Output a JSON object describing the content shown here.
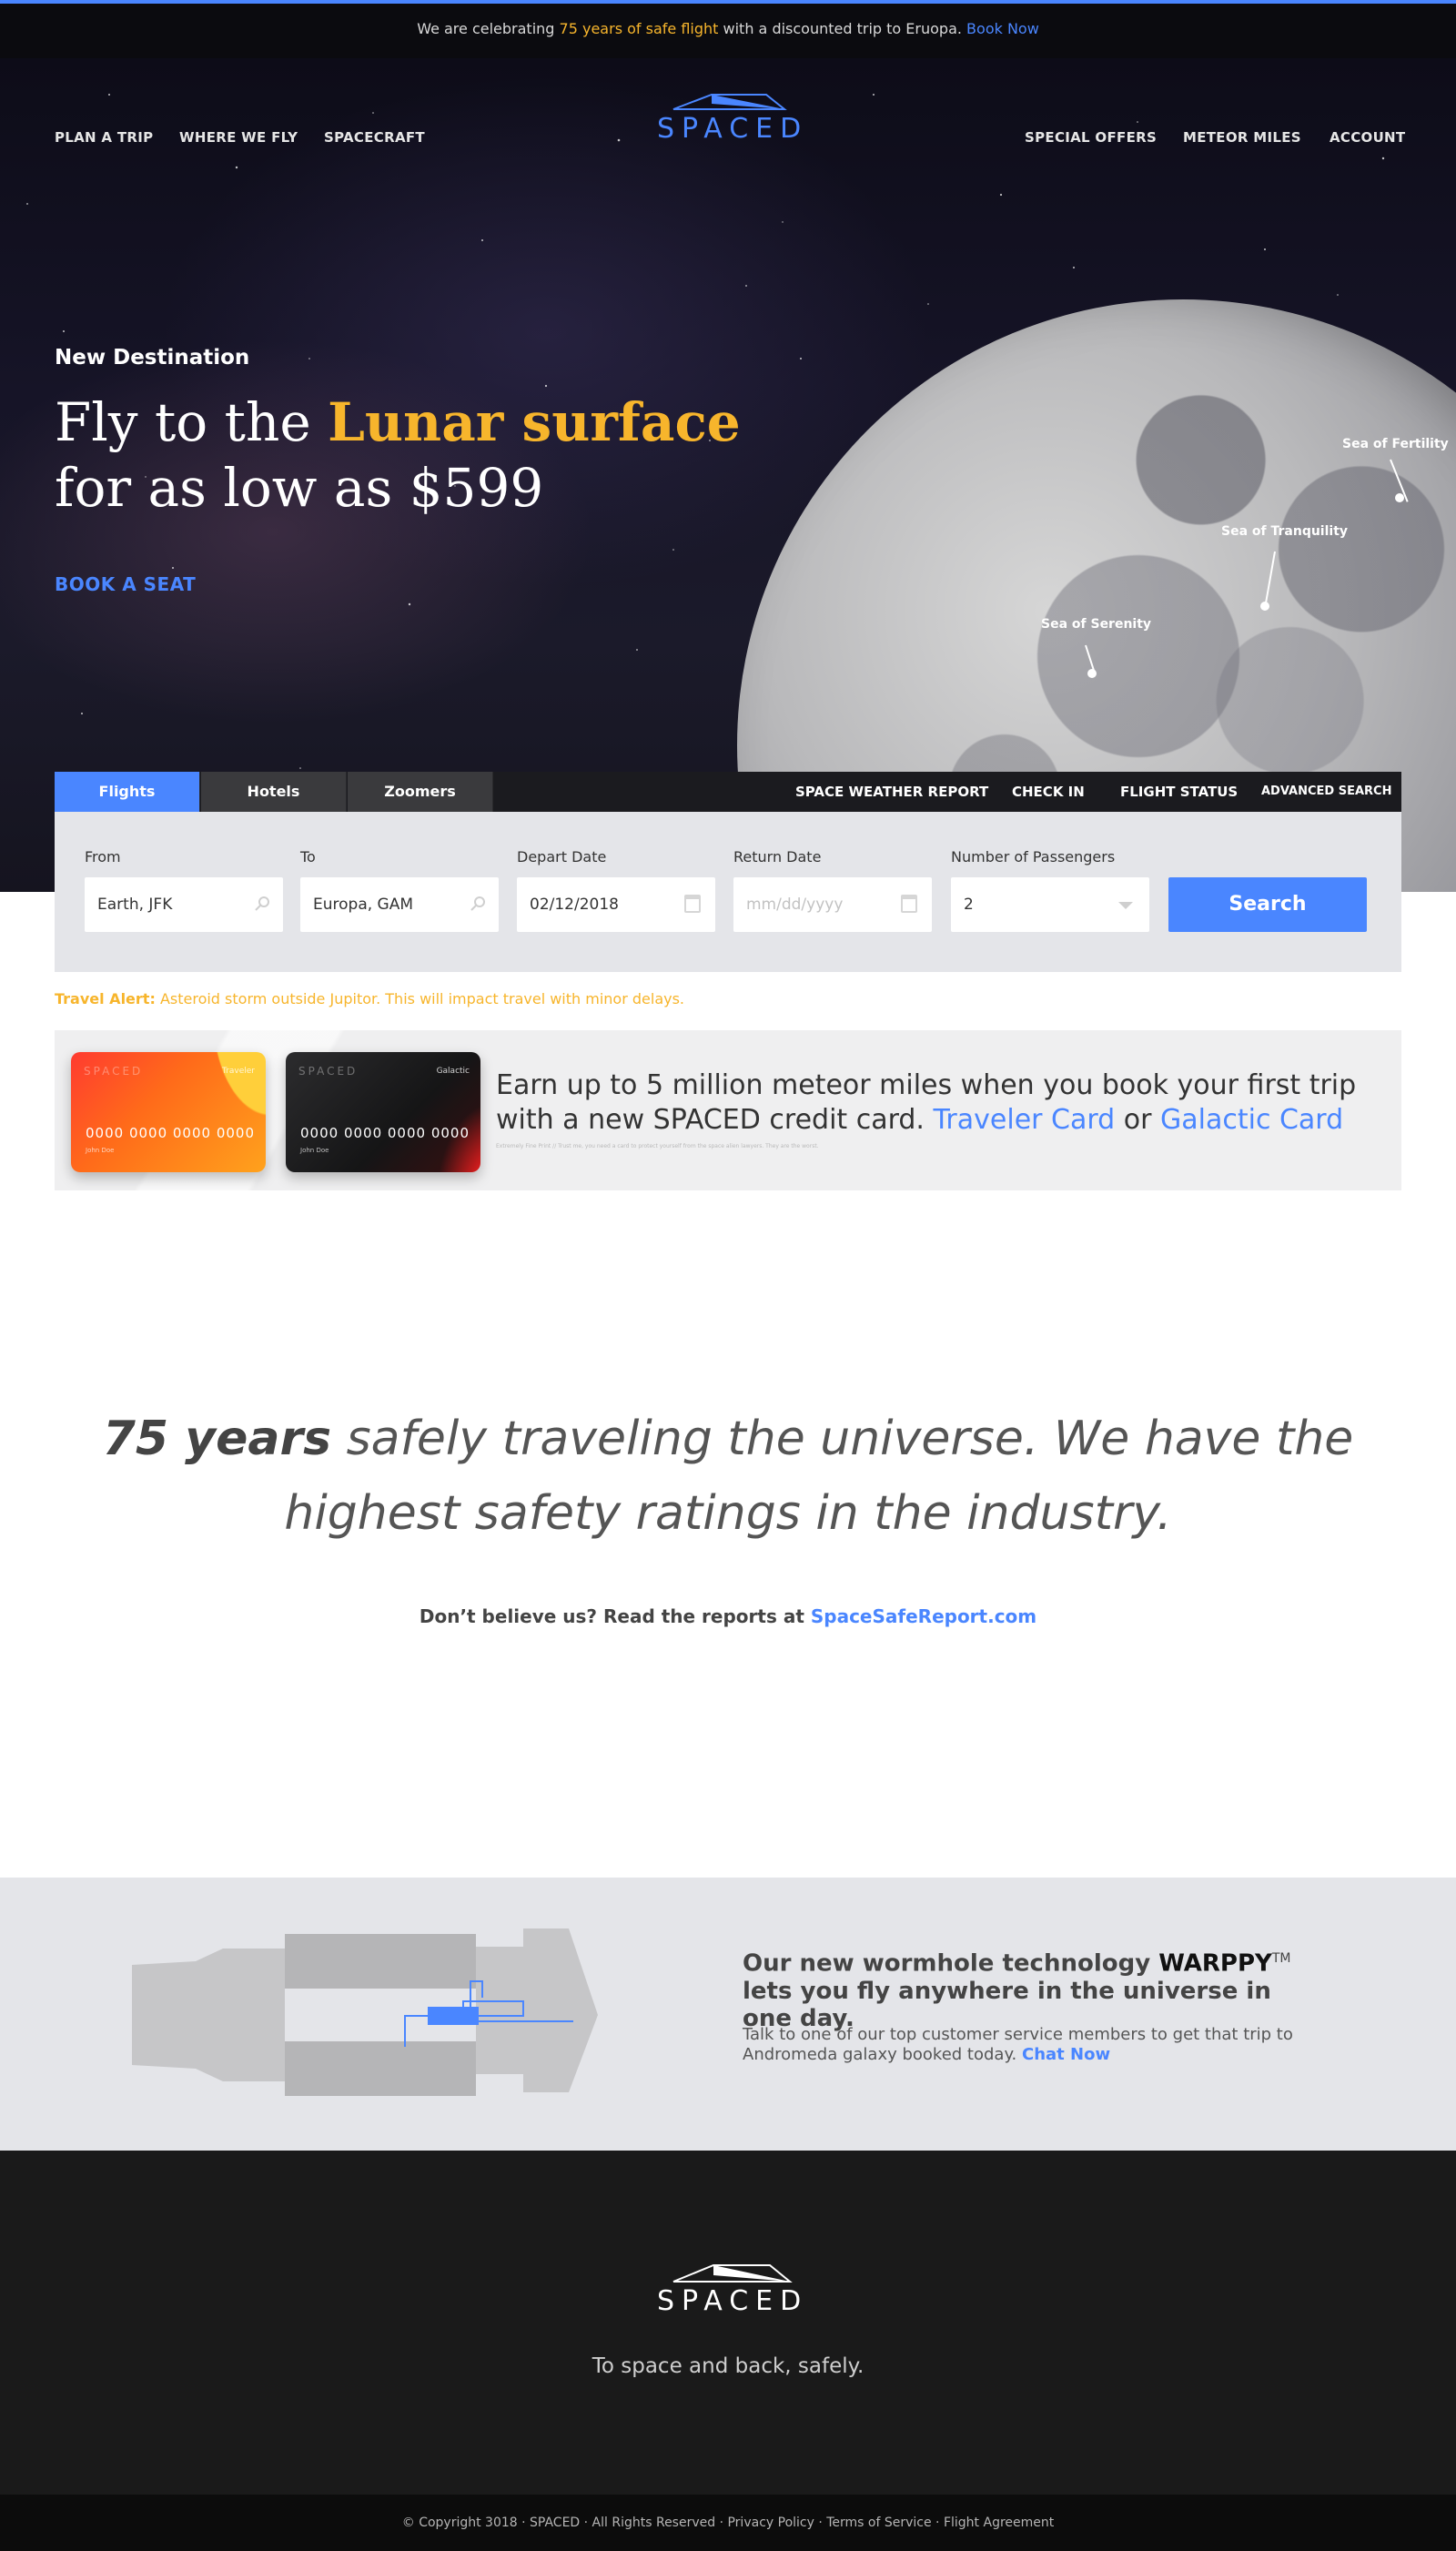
{
  "colors": {
    "accent": "#4a86ff",
    "gold": "#f7b52c",
    "dark": "#0b0b0f",
    "panel": "#e4e5e9"
  },
  "announcement": {
    "prefix": "We are celebrating",
    "highlight": "75 years of safe flight",
    "middle": "with a discounted trip to Eruopa.",
    "link": "Book Now"
  },
  "nav": {
    "left": [
      "PLAN A TRIP",
      "WHERE WE FLY",
      "SPACECRAFT"
    ],
    "right": [
      "SPECIAL OFFERS",
      "METEOR MILES",
      "ACCOUNT"
    ],
    "logo": "SPACED"
  },
  "hero": {
    "kicker": "New Destination",
    "title_pre": "Fly to the",
    "title_accent": "Lunar surface",
    "title_line2": "for as low as $599",
    "cta": "BOOK A SEAT",
    "moon_labels": [
      "Sea of Fertility",
      "Sea of Tranquility",
      "Sea of Serenity"
    ]
  },
  "booking": {
    "tabs": [
      "Flights",
      "Hotels",
      "Zoomers"
    ],
    "links": [
      "SPACE WEATHER REPORT",
      "CHECK IN",
      "FLIGHT STATUS",
      "ADVANCED SEARCH"
    ],
    "from": {
      "label": "From",
      "value": "Earth, JFK"
    },
    "to": {
      "label": "To",
      "value": "Europa, GAM"
    },
    "depart": {
      "label": "Depart Date",
      "value": "02/12/2018"
    },
    "return": {
      "label": "Return Date",
      "placeholder": "mm/dd/yyyy"
    },
    "passengers": {
      "label": "Number of Passengers",
      "value": "2"
    },
    "search": "Search"
  },
  "alert": {
    "label": "Travel Alert:",
    "text": "Asteroid storm outside Jupitor. This will impact travel with minor delays."
  },
  "promo": {
    "text": "Earn up to 5 million meteor miles when you book your first trip with a new SPACED credit card.",
    "card1": "Traveler Card",
    "or": "or",
    "card2": "Galactic Card",
    "fine_print": "Extremely Fine Print // Trust me, you need a card to protect yourself from the space alien lawyers. They are the worst.",
    "cards": [
      {
        "brand": "SPACED",
        "kind": "Traveler",
        "number": "0000 0000 0000 0000",
        "holder": "John Doe"
      },
      {
        "brand": "SPACED",
        "kind": "Galactic",
        "number": "0000 0000 0000 0000",
        "holder": "John Doe"
      }
    ]
  },
  "safety": {
    "bold": "75 years",
    "line1_rest": "safely traveling the universe. We have the",
    "line2": "highest safety ratings in the industry.",
    "reports_text": "Don’t believe us? Read the reports at",
    "reports_link": "SpaceSafeReport.com"
  },
  "warp": {
    "title_pre": "Our new wormhole technology",
    "brand": "WARPPY",
    "tm": "TM",
    "title_post": "lets you fly anywhere in the universe in one day.",
    "body": "Talk to one of our top customer service members to get that trip to Andromeda galaxy booked today.",
    "link": "Chat Now"
  },
  "footer": {
    "logo": "SPACED",
    "tagline": "To space and back, safely.",
    "copyright": "© Copyright 3018 · SPACED · All Rights Reserved · Privacy Policy · Terms of Service · Flight Agreement"
  }
}
